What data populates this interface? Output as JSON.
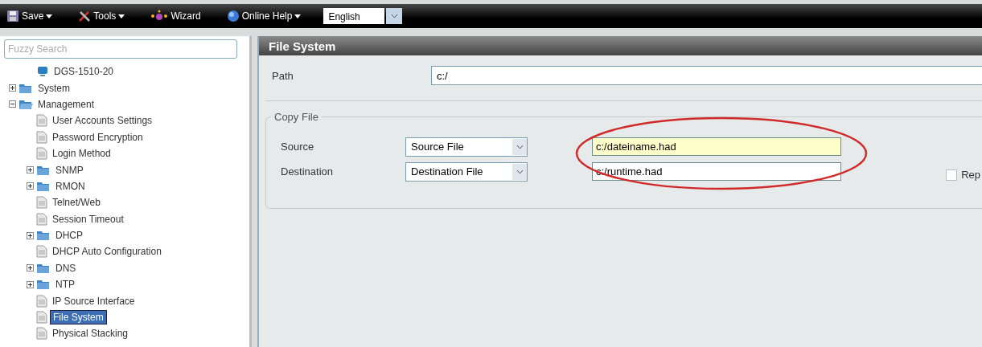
{
  "toolbar": {
    "items": [
      {
        "label": "Save",
        "kind": "save",
        "dropdown": true
      },
      {
        "label": "Tools",
        "kind": "tools",
        "dropdown": true
      },
      {
        "label": "Wizard",
        "kind": "wizard",
        "dropdown": false
      },
      {
        "label": "Online Help",
        "kind": "help",
        "dropdown": true
      }
    ],
    "language": "English"
  },
  "sidebar": {
    "search": {
      "placeholder": "Fuzzy Search"
    },
    "tree": [
      {
        "label": "DGS-1510-20",
        "kind": "device",
        "children": [
          {
            "label": "System",
            "kind": "folder",
            "expanded": false,
            "selected": false
          },
          {
            "label": "Management",
            "kind": "folder",
            "expanded": true,
            "selected": false,
            "children": [
              {
                "label": "User Accounts Settings",
                "kind": "page",
                "selected": false
              },
              {
                "label": "Password Encryption",
                "kind": "page",
                "selected": false
              },
              {
                "label": "Login Method",
                "kind": "page",
                "selected": false
              },
              {
                "label": "SNMP",
                "kind": "folder",
                "expanded": false,
                "selected": false
              },
              {
                "label": "RMON",
                "kind": "folder",
                "expanded": false,
                "selected": false
              },
              {
                "label": "Telnet/Web",
                "kind": "page",
                "selected": false
              },
              {
                "label": "Session Timeout",
                "kind": "page",
                "selected": false
              },
              {
                "label": "DHCP",
                "kind": "folder",
                "expanded": false,
                "selected": false
              },
              {
                "label": "DHCP Auto Configuration",
                "kind": "page",
                "selected": false
              },
              {
                "label": "DNS",
                "kind": "folder",
                "expanded": false,
                "selected": false
              },
              {
                "label": "NTP",
                "kind": "folder",
                "expanded": false,
                "selected": false
              },
              {
                "label": "IP Source Interface",
                "kind": "page",
                "selected": false
              },
              {
                "label": "File System",
                "kind": "page",
                "selected": true
              },
              {
                "label": "Physical Stacking",
                "kind": "page",
                "selected": false
              }
            ]
          }
        ]
      }
    ]
  },
  "panel": {
    "title": "File System",
    "path": {
      "label": "Path",
      "value": "c:/"
    },
    "copy_file": {
      "legend": "Copy File",
      "rows": [
        {
          "label": "Source",
          "select": "Source File",
          "value": "c:/dateiname.had",
          "focused": true
        },
        {
          "label": "Destination",
          "select": "Destination File",
          "value": "c:/runtime.had",
          "focused": false
        }
      ],
      "checkbox": {
        "label": "Rep",
        "checked": false
      }
    }
  }
}
